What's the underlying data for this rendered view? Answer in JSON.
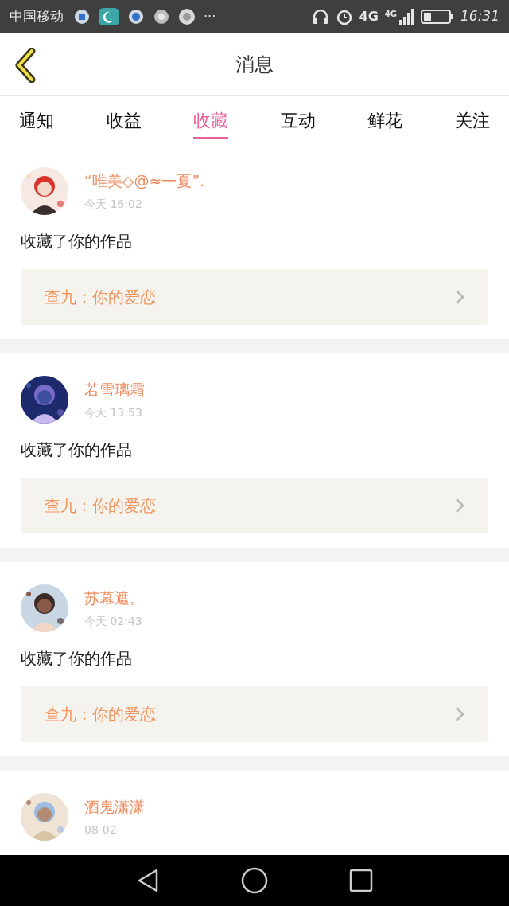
{
  "status_bar": {
    "carrier": "中国移动",
    "more": "···",
    "network": "4G",
    "signal_network": "4G",
    "time": "16:31"
  },
  "header": {
    "title": "消息"
  },
  "tabs": [
    {
      "label": "通知",
      "selected": false
    },
    {
      "label": "收益",
      "selected": false
    },
    {
      "label": "收藏",
      "selected": true
    },
    {
      "label": "互动",
      "selected": false
    },
    {
      "label": "鲜花",
      "selected": false
    },
    {
      "label": "关注",
      "selected": false
    }
  ],
  "messages": [
    {
      "user": "“唯美◇@≈一夏”.",
      "time": "今天 16:02",
      "text": "收藏了你的作品",
      "work": "查九：你的爱恋"
    },
    {
      "user": "若雪璃霜",
      "time": "今天 13:53",
      "text": "收藏了你的作品",
      "work": "查九：你的爱恋"
    },
    {
      "user": "苏幕遮。",
      "time": "今天 02:43",
      "text": "收藏了你的作品",
      "work": "查九：你的爱恋"
    },
    {
      "user": "酒鬼潇潇",
      "time": "08-02"
    }
  ]
}
